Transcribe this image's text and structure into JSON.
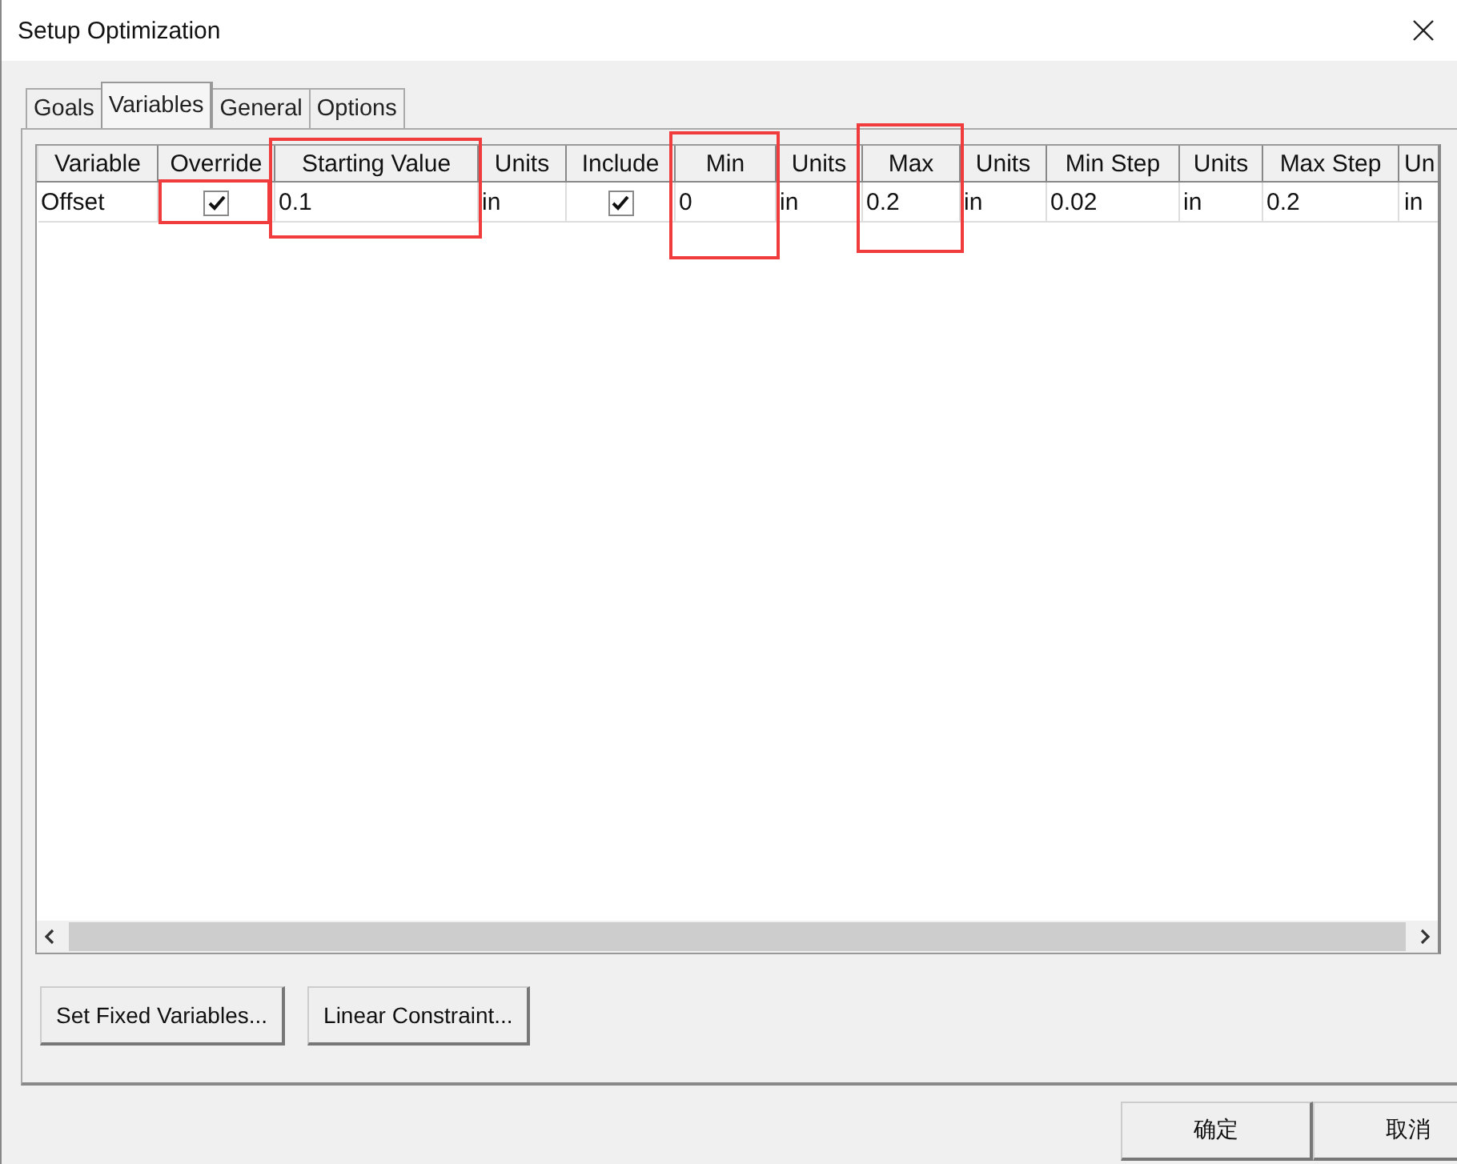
{
  "window": {
    "title": "Setup Optimization"
  },
  "tabs": [
    {
      "label": "Goals",
      "selected": false
    },
    {
      "label": "Variables",
      "selected": true
    },
    {
      "label": "General",
      "selected": false
    },
    {
      "label": "Options",
      "selected": false
    }
  ],
  "table": {
    "columns": [
      "Variable",
      "Override",
      "Starting Value",
      "Units",
      "Include",
      "Min",
      "Units",
      "Max",
      "Units",
      "Min Step",
      "Units",
      "Max Step",
      "Un"
    ],
    "rows": [
      {
        "cells": [
          {
            "kind": "text",
            "text": "Offset"
          },
          {
            "kind": "checkbox",
            "checked": true
          },
          {
            "kind": "text",
            "text": "0.1"
          },
          {
            "kind": "text",
            "text": "in"
          },
          {
            "kind": "checkbox",
            "checked": true
          },
          {
            "kind": "text",
            "text": "0"
          },
          {
            "kind": "text",
            "text": "in"
          },
          {
            "kind": "text",
            "text": "0.2"
          },
          {
            "kind": "text",
            "text": "in"
          },
          {
            "kind": "text",
            "text": "0.02"
          },
          {
            "kind": "text",
            "text": "in"
          },
          {
            "kind": "text",
            "text": "0.2"
          },
          {
            "kind": "text",
            "text": "in"
          }
        ]
      }
    ]
  },
  "panel_buttons": [
    "Set Fixed Variables...",
    "Linear Constraint..."
  ],
  "dialog_buttons": [
    "确定",
    "取消"
  ]
}
